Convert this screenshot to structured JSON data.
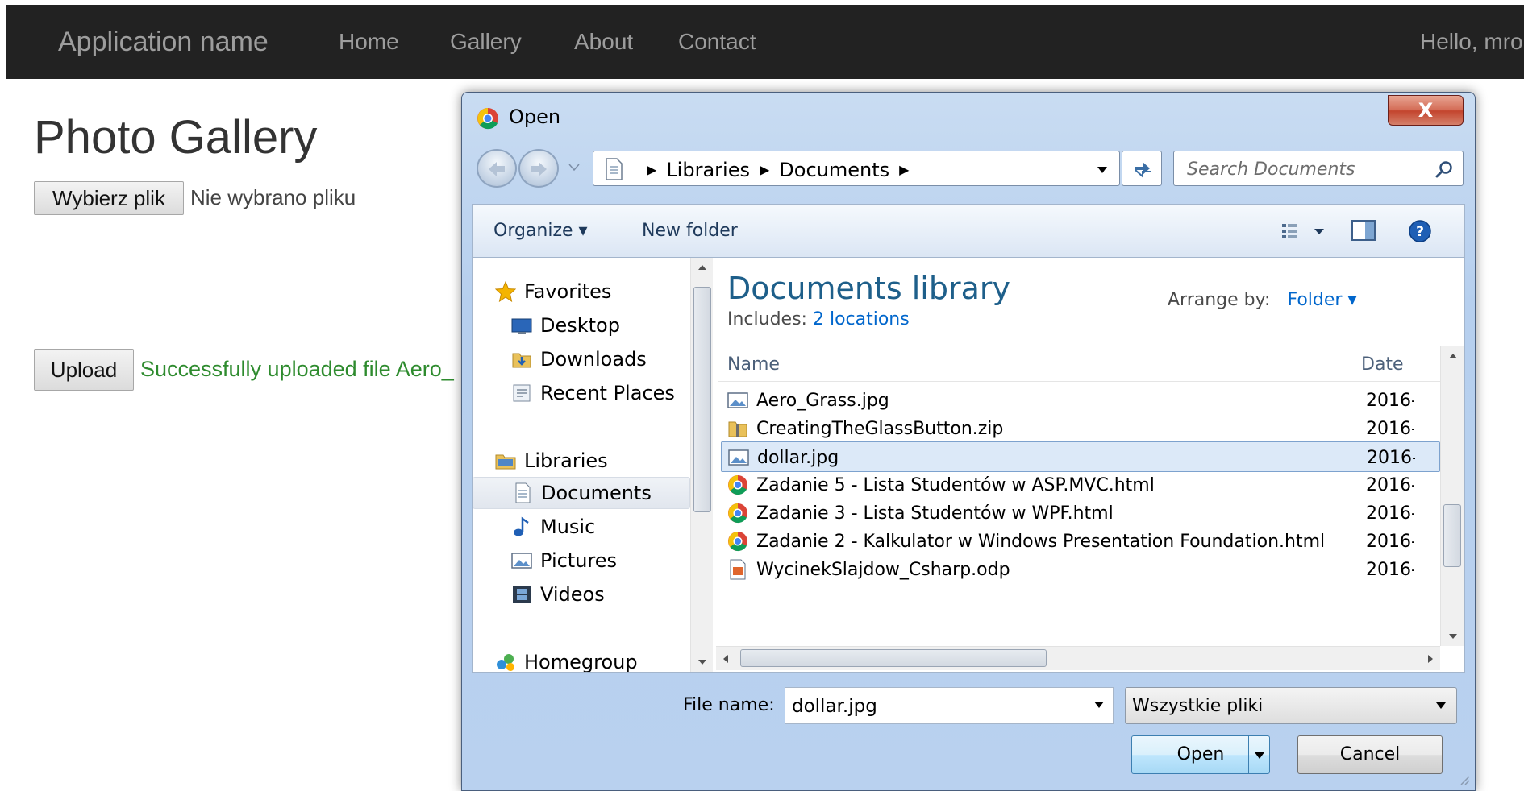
{
  "web": {
    "brand": "Application name",
    "nav": [
      "Home",
      "Gallery",
      "About",
      "Contact"
    ],
    "greeting": "Hello, mro",
    "title": "Photo Gallery",
    "choose_button": "Wybierz plik",
    "no_file": "Nie wybrano pliku",
    "upload_button": "Upload",
    "status": "Successfully uploaded file Aero_",
    "status_color": "#2e8b2e"
  },
  "dialog": {
    "title": "Open",
    "close_label": "X",
    "breadcrumb": [
      "Libraries",
      "Documents"
    ],
    "search_placeholder": "Search Documents",
    "organize": "Organize ▾",
    "new_folder": "New folder",
    "nav": {
      "favorites": "Favorites",
      "desktop": "Desktop",
      "downloads": "Downloads",
      "recent": "Recent Places",
      "libraries": "Libraries",
      "documents": "Documents",
      "music": "Music",
      "pictures": "Pictures",
      "videos": "Videos",
      "homegroup": "Homegroup"
    },
    "library_title": "Documents library",
    "includes_label": "Includes:",
    "includes_link": "2 locations",
    "arrange_label": "Arrange by:",
    "arrange_value": "Folder ▾",
    "columns": {
      "name": "Name",
      "date": "Date"
    },
    "files": [
      {
        "name": "Aero_Grass.jpg",
        "date": "2016-",
        "icon": "image-icon"
      },
      {
        "name": "CreatingTheGlassButton.zip",
        "date": "2016-",
        "icon": "zip-icon"
      },
      {
        "name": "dollar.jpg",
        "date": "2016-",
        "icon": "image-icon",
        "selected": true
      },
      {
        "name": "Zadanie 5 - Lista Studentów w ASP.MVC.html",
        "date": "2016-",
        "icon": "chrome-icon"
      },
      {
        "name": "Zadanie 3 - Lista Studentów w WPF.html",
        "date": "2016-",
        "icon": "chrome-icon"
      },
      {
        "name": "Zadanie 2 - Kalkulator w Windows Presentation Foundation.html",
        "date": "2016-",
        "icon": "chrome-icon"
      },
      {
        "name": "WycinekSlajdow_Csharp.odp",
        "date": "2016-",
        "icon": "odp-icon"
      }
    ],
    "file_name_label": "File name:",
    "file_name_value": "dollar.jpg",
    "filter_value": "Wszystkie pliki",
    "open_button": "Open",
    "cancel_button": "Cancel"
  }
}
